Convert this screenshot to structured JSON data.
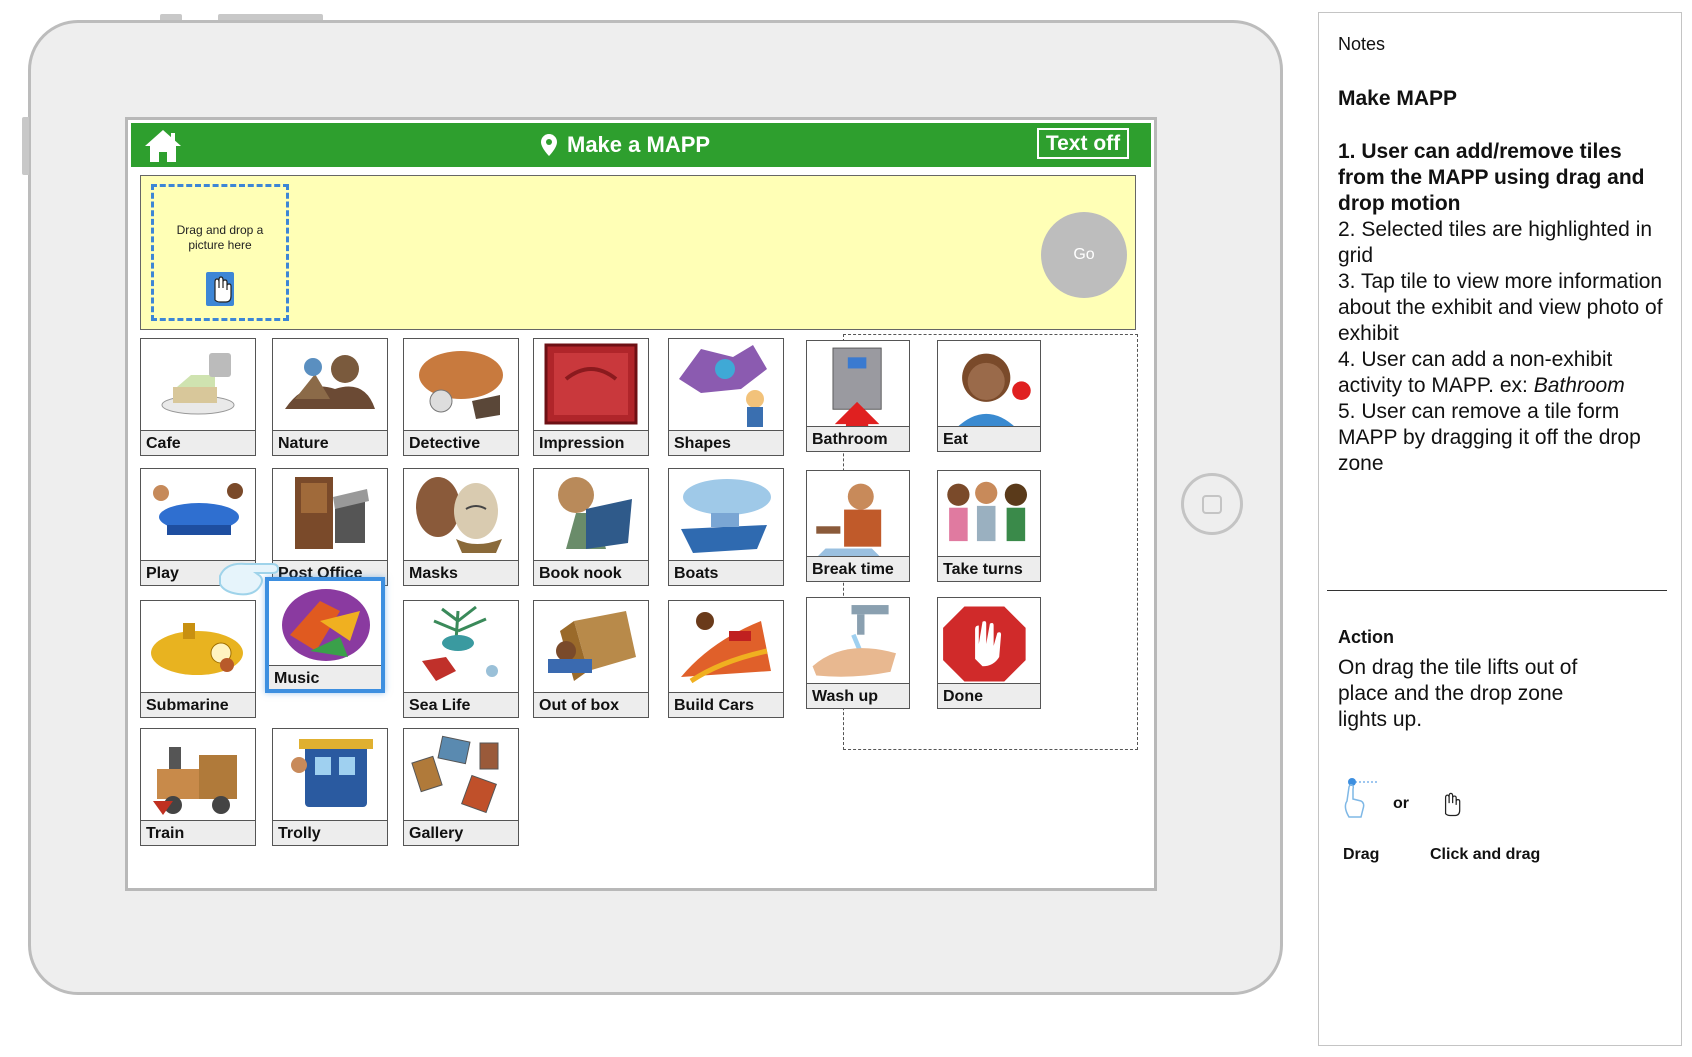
{
  "app": {
    "title": "Make a MAPP",
    "text_toggle_label": "Text off",
    "go_label": "Go"
  },
  "dropzone": {
    "instruction": "Drag and drop a picture here"
  },
  "tiles": [
    {
      "label": "Cafe",
      "icon": "cafe-icon"
    },
    {
      "label": "Nature",
      "icon": "nature-icon"
    },
    {
      "label": "Detective",
      "icon": "detective-icon"
    },
    {
      "label": "Impression",
      "icon": "impression-icon"
    },
    {
      "label": "Shapes",
      "icon": "shapes-icon"
    },
    {
      "label": "Play",
      "icon": "play-icon"
    },
    {
      "label": "Post Office",
      "icon": "post-office-icon"
    },
    {
      "label": "Masks",
      "icon": "masks-icon"
    },
    {
      "label": "Book nook",
      "icon": "book-nook-icon"
    },
    {
      "label": "Boats",
      "icon": "boats-icon"
    },
    {
      "label": "Submarine",
      "icon": "submarine-icon"
    },
    {
      "label": "Music",
      "icon": "music-icon"
    },
    {
      "label": "Sea Life",
      "icon": "sea-life-icon"
    },
    {
      "label": "Out of box",
      "icon": "out-of-box-icon"
    },
    {
      "label": "Build Cars",
      "icon": "build-cars-icon"
    },
    {
      "label": "Train",
      "icon": "train-icon"
    },
    {
      "label": "Trolly",
      "icon": "trolly-icon"
    },
    {
      "label": "Gallery",
      "icon": "gallery-icon"
    }
  ],
  "activity_tiles": [
    {
      "label": "Bathroom",
      "icon": "bathroom-icon"
    },
    {
      "label": "Eat",
      "icon": "eat-icon"
    },
    {
      "label": "Break time",
      "icon": "break-time-icon"
    },
    {
      "label": "Take turns",
      "icon": "take-turns-icon"
    },
    {
      "label": "Wash up",
      "icon": "wash-up-icon"
    },
    {
      "label": "Done",
      "icon": "done-icon"
    }
  ],
  "notes": {
    "heading": "Notes",
    "title": "Make MAPP",
    "items": [
      "1. User can add/remove tiles from the MAPP using drag and drop motion",
      "2. Selected tiles are highlighted in grid",
      "3. Tap tile to view more information about the exhibit and view photo of exhibit",
      "4. User can add a non-exhibit activity to MAPP. ex: ",
      "5. User can remove a tile form MAPP by dragging it off the drop zone"
    ],
    "item4_example": "Bathroom",
    "action_heading": "Action",
    "action_text": "On drag the tile lifts out of place and the drop zone lights up.",
    "or_text": "or",
    "drag_label": "Drag",
    "click_drag_label": "Click and drag"
  },
  "colors": {
    "topbar": "#2e9f2e",
    "dropzone_bg": "#ffffb6",
    "dropzone_border": "#3d86d6",
    "go_button": "#bdbdbd"
  }
}
